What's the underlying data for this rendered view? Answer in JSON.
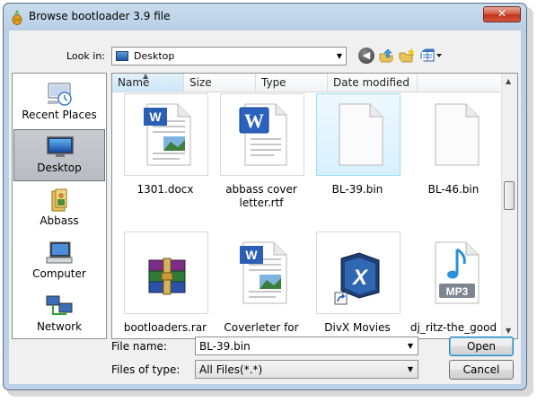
{
  "window": {
    "title": "Browse bootloader 3.9 file",
    "close_label": "✕"
  },
  "toolbar": {
    "look_in_label": "Look in:",
    "look_in_value": "Desktop",
    "back_label": "◀"
  },
  "places": [
    {
      "label": "Recent Places",
      "icon": "recent-places-icon"
    },
    {
      "label": "Desktop",
      "icon": "desktop-icon",
      "selected": true
    },
    {
      "label": "Abbass",
      "icon": "user-folder-icon"
    },
    {
      "label": "Computer",
      "icon": "computer-icon"
    },
    {
      "label": "Network",
      "icon": "network-icon"
    }
  ],
  "columns": [
    "Name",
    "Size",
    "Type",
    "Date modified"
  ],
  "files": [
    {
      "name": "1301.docx",
      "icon": "word-docx-icon"
    },
    {
      "name": "abbass cover letter.rtf",
      "icon": "word-rtf-icon"
    },
    {
      "name": "BL-39.bin",
      "icon": "blank-file-icon",
      "selected": true
    },
    {
      "name": "BL-46.bin",
      "icon": "blank-file-icon"
    },
    {
      "name": "bootloaders.rar",
      "icon": "winrar-archive-icon"
    },
    {
      "name": "Coverleter for",
      "icon": "word-docx-icon"
    },
    {
      "name": "DivX Movies",
      "icon": "divx-shortcut-icon"
    },
    {
      "name": "dj_ritz-the_good",
      "icon": "mp3-file-icon"
    }
  ],
  "file_name": {
    "label": "File name:",
    "value": "BL-39.bin"
  },
  "file_type": {
    "label": "Files of type:",
    "value": "All Files(*.*)"
  },
  "buttons": {
    "open": "Open",
    "cancel": "Cancel"
  }
}
